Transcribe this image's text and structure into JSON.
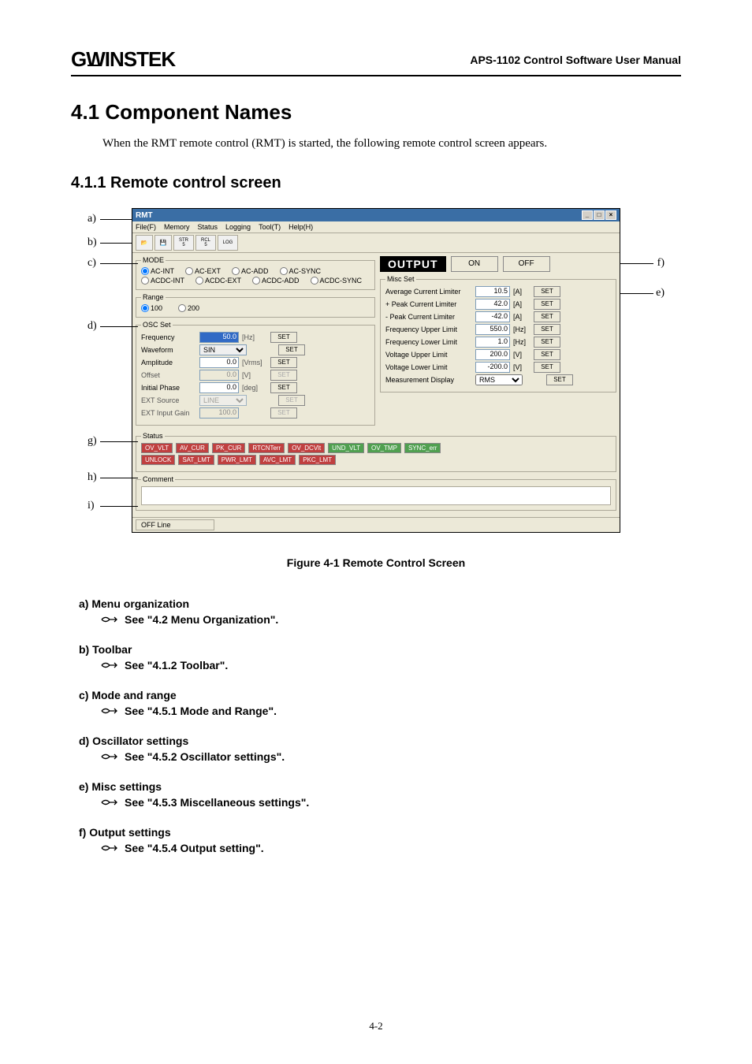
{
  "header": {
    "logo": "GWINSTEK",
    "manual_title": "APS-1102 Control Software User Manual"
  },
  "section": {
    "num_title": "4.1   Component Names",
    "intro": "When the RMT remote control (RMT) is started, the following remote control screen appears.",
    "sub_num_title": "4.1.1    Remote control screen"
  },
  "callouts": {
    "a": "a)",
    "b": "b)",
    "c": "c)",
    "d": "d)",
    "e": "e)",
    "f": "f)",
    "g": "g)",
    "h": "h)",
    "i": "i)"
  },
  "window": {
    "title": "RMT",
    "menus": [
      "File(F)",
      "Memory",
      "Status",
      "Logging",
      "Tool(T)",
      "Help(H)"
    ],
    "toolbar_labels": {
      "str": "STR",
      "rcl": "RCL",
      "log": "LOG"
    },
    "mode": {
      "legend": "MODE",
      "options": [
        "AC-INT",
        "AC-EXT",
        "AC-ADD",
        "AC-SYNC",
        "ACDC-INT",
        "ACDC-EXT",
        "ACDC-ADD",
        "ACDC-SYNC"
      ]
    },
    "range": {
      "legend": "Range",
      "options": [
        "100",
        "200"
      ]
    },
    "osc": {
      "legend": "OSC Set",
      "rows": {
        "frequency": {
          "label": "Frequency",
          "value": "50.0",
          "unit": "[Hz]",
          "btn": "SET"
        },
        "waveform": {
          "label": "Waveform",
          "value": "SIN",
          "btn": "SET"
        },
        "amplitude": {
          "label": "Amplitude",
          "value": "0.0",
          "unit": "[Vrms]",
          "btn": "SET"
        },
        "offset": {
          "label": "Offset",
          "value": "0.0",
          "unit": "[V]",
          "btn": "SET"
        },
        "phase": {
          "label": "Initial Phase",
          "value": "0.0",
          "unit": "[deg]",
          "btn": "SET"
        },
        "extsrc": {
          "label": "EXT Source",
          "value": "LINE",
          "btn": "SET"
        },
        "extgain": {
          "label": "EXT Input Gain",
          "value": "100.0",
          "btn": "SET"
        }
      }
    },
    "output": {
      "label": "OUTPUT",
      "on": "ON",
      "off": "OFF"
    },
    "misc": {
      "legend": "Misc Set",
      "rows": {
        "avg_cur": {
          "label": "Average Current Limiter",
          "value": "10.5",
          "unit": "[A]",
          "btn": "SET"
        },
        "ppk_cur": {
          "label": "+ Peak Current Limiter",
          "value": "42.0",
          "unit": "[A]",
          "btn": "SET"
        },
        "npk_cur": {
          "label": "- Peak Current Limiter",
          "value": "-42.0",
          "unit": "[A]",
          "btn": "SET"
        },
        "freq_up": {
          "label": "Frequency Upper Limit",
          "value": "550.0",
          "unit": "[Hz]",
          "btn": "SET"
        },
        "freq_lo": {
          "label": "Frequency Lower Limit",
          "value": "1.0",
          "unit": "[Hz]",
          "btn": "SET"
        },
        "volt_up": {
          "label": "Voltage Upper Limit",
          "value": "200.0",
          "unit": "[V]",
          "btn": "SET"
        },
        "volt_lo": {
          "label": "Voltage Lower Limit",
          "value": "-200.0",
          "unit": "[V]",
          "btn": "SET"
        },
        "meas": {
          "label": "Measurement Display",
          "value": "RMS",
          "btn": "SET"
        }
      }
    },
    "status": {
      "legend": "Status",
      "flags_row1": [
        "OV_VLT",
        "AV_CUR",
        "PK_CUR",
        "RTCNTerr",
        "OV_DCVlt",
        "UND_VLT",
        "OV_TMP",
        "SYNC_err"
      ],
      "flags_row2": [
        "UNLOCK",
        "SAT_LMT",
        "PWR_LMT",
        "AVC_LMT",
        "PKC_LMT"
      ]
    },
    "comment_legend": "Comment",
    "statusbar": "OFF Line"
  },
  "figure_caption": "Figure 4-1  Remote Control Screen",
  "items": {
    "a": {
      "head": "a)  Menu organization",
      "ref": "See \"4.2  Menu Organization\"."
    },
    "b": {
      "head": "b)  Toolbar",
      "ref": "See \"4.1.2  Toolbar\"."
    },
    "c": {
      "head": "c)  Mode and range",
      "ref": "See \"4.5.1  Mode and Range\"."
    },
    "d": {
      "head": "d)  Oscillator settings",
      "ref": "See \"4.5.2  Oscillator settings\"."
    },
    "e": {
      "head": "e)  Misc settings",
      "ref": "See \"4.5.3  Miscellaneous settings\"."
    },
    "f": {
      "head": "f)  Output settings",
      "ref": "See \"4.5.4  Output setting\"."
    }
  },
  "page_num": "4-2"
}
